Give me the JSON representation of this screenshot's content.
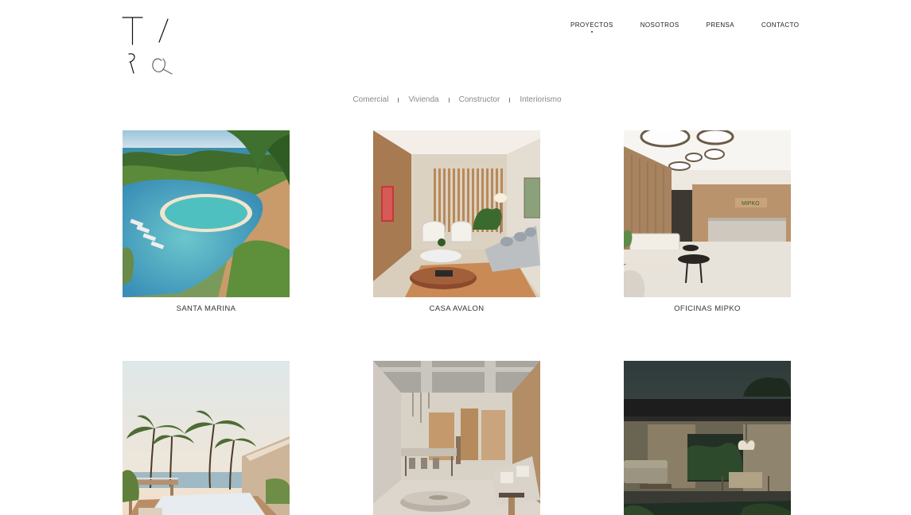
{
  "nav": {
    "items": [
      {
        "label": "PROYECTOS",
        "active": true
      },
      {
        "label": "NOSOTROS",
        "active": false
      },
      {
        "label": "PRENSA",
        "active": false
      },
      {
        "label": "CONTACTO",
        "active": false
      }
    ]
  },
  "filters": [
    "Comercial",
    "Vivienda",
    "Constructor",
    "Interiorismo"
  ],
  "projects": [
    {
      "title": "SANTA MARINA",
      "image": "resort-pool-image"
    },
    {
      "title": "CASA AVALON",
      "image": "living-room-image"
    },
    {
      "title": "OFICINAS MIPKO",
      "image": "office-lobby-image",
      "sign_text": "MIPKO"
    },
    {
      "title": "",
      "image": "beach-terrace-image"
    },
    {
      "title": "",
      "image": "modern-interior-image"
    },
    {
      "title": "",
      "image": "night-terrace-image"
    }
  ]
}
